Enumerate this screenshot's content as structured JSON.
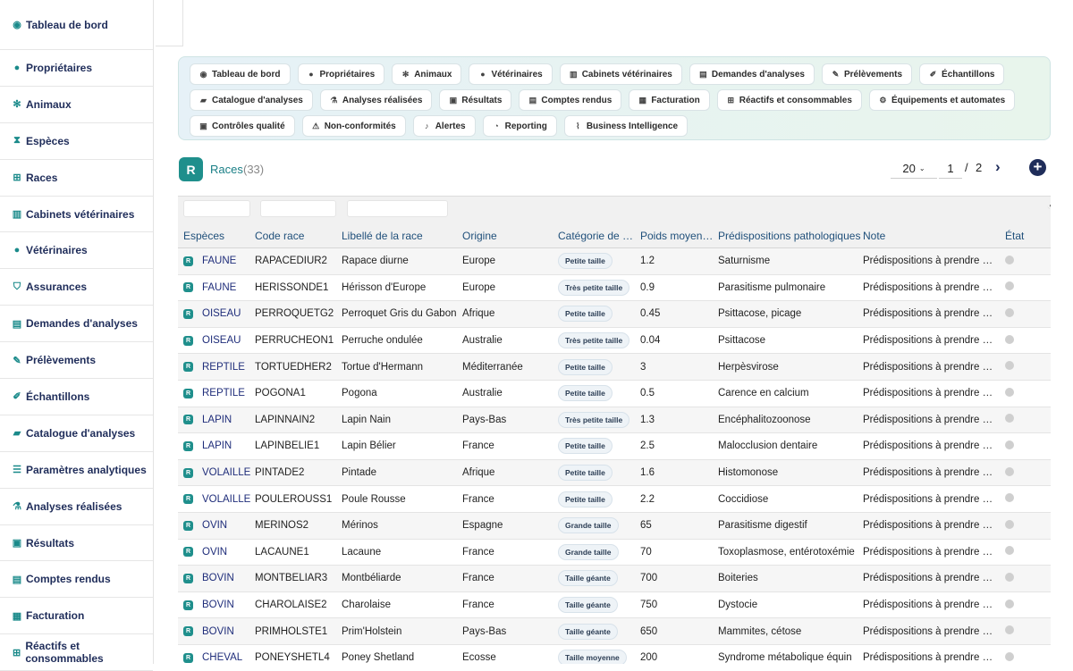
{
  "sidebar": {
    "items": [
      {
        "label": "Tableau de bord",
        "icon": "dashboard-icon",
        "glyph": "◉"
      },
      {
        "label": "Propriétaires",
        "icon": "user-icon",
        "glyph": "●"
      },
      {
        "label": "Animaux",
        "icon": "paw-icon",
        "glyph": "✻"
      },
      {
        "label": "Espèces",
        "icon": "hourglass-icon",
        "glyph": "⧗"
      },
      {
        "label": "Races",
        "icon": "sitemap-icon",
        "glyph": "⊞"
      },
      {
        "label": "Cabinets vétérinaires",
        "icon": "building-icon",
        "glyph": "▥"
      },
      {
        "label": "Vétérinaires",
        "icon": "doctor-icon",
        "glyph": "●"
      },
      {
        "label": "Assurances",
        "icon": "shield-icon",
        "glyph": "⛉"
      },
      {
        "label": "Demandes d'analyses",
        "icon": "file-icon",
        "glyph": "▤"
      },
      {
        "label": "Prélèvements",
        "icon": "syringe-icon",
        "glyph": "✎"
      },
      {
        "label": "Échantillons",
        "icon": "vial-icon",
        "glyph": "✐"
      },
      {
        "label": "Catalogue d'analyses",
        "icon": "book-icon",
        "glyph": "▰"
      },
      {
        "label": "Paramètres analytiques",
        "icon": "list-icon",
        "glyph": "☰"
      },
      {
        "label": "Analyses réalisées",
        "icon": "flask-icon",
        "glyph": "⚗"
      },
      {
        "label": "Résultats",
        "icon": "clipboard-icon",
        "glyph": "▣"
      },
      {
        "label": "Comptes rendus",
        "icon": "report-icon",
        "glyph": "▤"
      },
      {
        "label": "Facturation",
        "icon": "invoice-icon",
        "glyph": "▦"
      },
      {
        "label": "Réactifs et consommables",
        "icon": "boxes-icon",
        "glyph": "⊞"
      }
    ]
  },
  "quicknav": [
    {
      "label": "Tableau de bord",
      "icon": "dashboard-icon",
      "glyph": "◉"
    },
    {
      "label": "Propriétaires",
      "icon": "user-icon",
      "glyph": "●"
    },
    {
      "label": "Animaux",
      "icon": "paw-icon",
      "glyph": "✻"
    },
    {
      "label": "Vétérinaires",
      "icon": "doctor-icon",
      "glyph": "●"
    },
    {
      "label": "Cabinets vétérinaires",
      "icon": "building-icon",
      "glyph": "▥"
    },
    {
      "label": "Demandes d'analyses",
      "icon": "file-icon",
      "glyph": "▤"
    },
    {
      "label": "Prélèvements",
      "icon": "syringe-icon",
      "glyph": "✎"
    },
    {
      "label": "Échantillons",
      "icon": "vial-icon",
      "glyph": "✐"
    },
    {
      "label": "Catalogue d'analyses",
      "icon": "book-icon",
      "glyph": "▰"
    },
    {
      "label": "Analyses réalisées",
      "icon": "flask-icon",
      "glyph": "⚗"
    },
    {
      "label": "Résultats",
      "icon": "clipboard-icon",
      "glyph": "▣"
    },
    {
      "label": "Comptes rendus",
      "icon": "report-icon",
      "glyph": "▤"
    },
    {
      "label": "Facturation",
      "icon": "invoice-icon",
      "glyph": "▦"
    },
    {
      "label": "Réactifs et consommables",
      "icon": "boxes-icon",
      "glyph": "⊞"
    },
    {
      "label": "Équipements et automates",
      "icon": "cogs-icon",
      "glyph": "⚙"
    },
    {
      "label": "Contrôles qualité",
      "icon": "checklist-icon",
      "glyph": "▣"
    },
    {
      "label": "Non-conformités",
      "icon": "warning-icon",
      "glyph": "⚠"
    },
    {
      "label": "Alertes",
      "icon": "bell-icon",
      "glyph": "♪"
    },
    {
      "label": "Reporting",
      "icon": "pie-chart-icon",
      "glyph": "◔"
    },
    {
      "label": "Business Intelligence",
      "icon": "line-chart-icon",
      "glyph": "⌇"
    }
  ],
  "header": {
    "logo": "R",
    "title": "Races",
    "count": "(33)",
    "per_page": "20",
    "page": "1",
    "page_sep": "/",
    "total_pages": "2",
    "next_glyph": "›",
    "add_glyph": "+"
  },
  "table": {
    "columns": [
      "Espèces",
      "Code race",
      "Libellé de la race",
      "Origine",
      "Catégorie de …",
      "Poids moyen…",
      "Prédispositions pathologiques",
      "Note",
      "État"
    ],
    "rows": [
      {
        "espece": "FAUNE",
        "code": "RAPACEDIUR2",
        "libelle": "Rapace diurne",
        "origine": "Europe",
        "categorie": "Petite taille",
        "poids": "1.2",
        "predisp": "Saturnisme",
        "note": "Prédispositions à prendre e…"
      },
      {
        "espece": "FAUNE",
        "code": "HERISSONDE1",
        "libelle": "Hérisson d'Europe",
        "origine": "Europe",
        "categorie": "Très petite taille",
        "poids": "0.9",
        "predisp": "Parasitisme pulmonaire",
        "note": "Prédispositions à prendre e…"
      },
      {
        "espece": "OISEAU",
        "code": "PERROQUETG2",
        "libelle": "Perroquet Gris du Gabon",
        "origine": "Afrique",
        "categorie": "Petite taille",
        "poids": "0.45",
        "predisp": "Psittacose, picage",
        "note": "Prédispositions à prendre e…"
      },
      {
        "espece": "OISEAU",
        "code": "PERRUCHEON1",
        "libelle": "Perruche ondulée",
        "origine": "Australie",
        "categorie": "Très petite taille",
        "poids": "0.04",
        "predisp": "Psittacose",
        "note": "Prédispositions à prendre e…"
      },
      {
        "espece": "REPTILE",
        "code": "TORTUEDHER2",
        "libelle": "Tortue d'Hermann",
        "origine": "Méditerranée",
        "categorie": "Petite taille",
        "poids": "3",
        "predisp": "Herpèsvirose",
        "note": "Prédispositions à prendre e…"
      },
      {
        "espece": "REPTILE",
        "code": "POGONA1",
        "libelle": "Pogona",
        "origine": "Australie",
        "categorie": "Petite taille",
        "poids": "0.5",
        "predisp": "Carence en calcium",
        "note": "Prédispositions à prendre e…"
      },
      {
        "espece": "LAPIN",
        "code": "LAPINNAIN2",
        "libelle": "Lapin Nain",
        "origine": "Pays-Bas",
        "categorie": "Très petite taille",
        "poids": "1.3",
        "predisp": "Encéphalitozoonose",
        "note": "Prédispositions à prendre e…"
      },
      {
        "espece": "LAPIN",
        "code": "LAPINBELIE1",
        "libelle": "Lapin Bélier",
        "origine": "France",
        "categorie": "Petite taille",
        "poids": "2.5",
        "predisp": "Malocclusion dentaire",
        "note": "Prédispositions à prendre e…"
      },
      {
        "espece": "VOLAILLE",
        "code": "PINTADE2",
        "libelle": "Pintade",
        "origine": "Afrique",
        "categorie": "Petite taille",
        "poids": "1.6",
        "predisp": "Histomonose",
        "note": "Prédispositions à prendre e…"
      },
      {
        "espece": "VOLAILLE",
        "code": "POULEROUSS1",
        "libelle": "Poule Rousse",
        "origine": "France",
        "categorie": "Petite taille",
        "poids": "2.2",
        "predisp": "Coccidiose",
        "note": "Prédispositions à prendre e…"
      },
      {
        "espece": "OVIN",
        "code": "MERINOS2",
        "libelle": "Mérinos",
        "origine": "Espagne",
        "categorie": "Grande taille",
        "poids": "65",
        "predisp": "Parasitisme digestif",
        "note": "Prédispositions à prendre e…"
      },
      {
        "espece": "OVIN",
        "code": "LACAUNE1",
        "libelle": "Lacaune",
        "origine": "France",
        "categorie": "Grande taille",
        "poids": "70",
        "predisp": "Toxoplasmose, entérotoxémie",
        "note": "Prédispositions à prendre e…"
      },
      {
        "espece": "BOVIN",
        "code": "MONTBELIAR3",
        "libelle": "Montbéliarde",
        "origine": "France",
        "categorie": "Taille géante",
        "poids": "700",
        "predisp": "Boiteries",
        "note": "Prédispositions à prendre e…"
      },
      {
        "espece": "BOVIN",
        "code": "CHAROLAISE2",
        "libelle": "Charolaise",
        "origine": "France",
        "categorie": "Taille géante",
        "poids": "750",
        "predisp": "Dystocie",
        "note": "Prédispositions à prendre e…"
      },
      {
        "espece": "BOVIN",
        "code": "PRIMHOLSTE1",
        "libelle": "Prim'Holstein",
        "origine": "Pays-Bas",
        "categorie": "Taille géante",
        "poids": "650",
        "predisp": "Mammites, cétose",
        "note": "Prédispositions à prendre e…"
      },
      {
        "espece": "CHEVAL",
        "code": "PONEYSHETL4",
        "libelle": "Poney Shetland",
        "origine": "Écosse",
        "categorie": "Taille moyenne",
        "poids": "200",
        "predisp": "Syndrome métabolique équin",
        "note": "Prédispositions à prendre e…"
      }
    ]
  },
  "row_icon": "R",
  "colors": {
    "accent": "#1f8f8c",
    "nav": "#1f2d5a"
  }
}
